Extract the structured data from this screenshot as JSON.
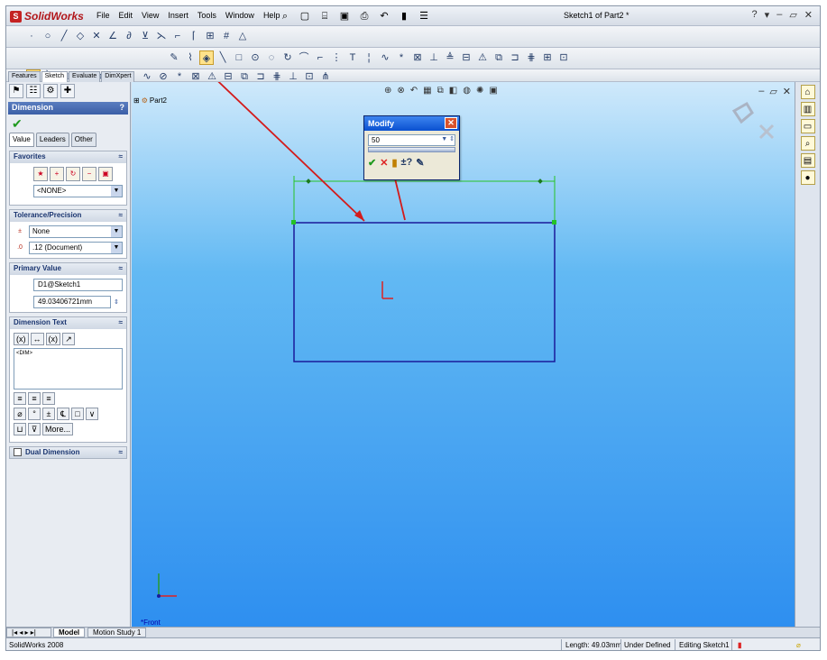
{
  "app": {
    "name": "SolidWorks",
    "document_title": "Sketch1 of Part2 *",
    "window_controls": [
      "?",
      "▾",
      "–",
      "▱",
      "✕"
    ]
  },
  "menu": [
    "File",
    "Edit",
    "View",
    "Insert",
    "Tools",
    "Window",
    "Help"
  ],
  "left_tabs": [
    "Features",
    "Sketch",
    "Evaluate",
    "DimXpert"
  ],
  "property_manager": {
    "title": "Dimension",
    "help": "?",
    "sub_tabs": [
      "Value",
      "Leaders",
      "Other"
    ],
    "favorites": {
      "header": "Favorites",
      "selected": "<NONE>"
    },
    "tolerance": {
      "header": "Tolerance/Precision",
      "tolerance_type": "None",
      "precision": ".12 (Document)"
    },
    "primary_value": {
      "header": "Primary Value",
      "name": "D1@Sketch1",
      "value": "49.03406721mm"
    },
    "dimension_text": {
      "header": "Dimension Text",
      "text": "<DIM>",
      "more_button": "More..."
    },
    "dual_dimension": {
      "header": "Dual Dimension"
    }
  },
  "tree": {
    "part": "Part2"
  },
  "modify_dialog": {
    "title": "Modify",
    "value": "50"
  },
  "canvas": {
    "view_label": "*Front"
  },
  "bottom_tabs": [
    "Model",
    "Motion Study 1"
  ],
  "status": {
    "app_version": "SolidWorks 2008",
    "length": "Length: 49.03mm",
    "state": "Under Defined",
    "mode": "Editing Sketch1"
  }
}
